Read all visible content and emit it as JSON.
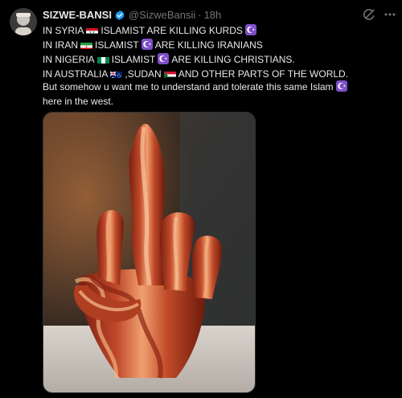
{
  "post": {
    "author_name": "SIZWE-BANSI",
    "handle": "@SizweBansii",
    "separator": "·",
    "time": "18h",
    "lines": {
      "l1a": "IN SYRIA",
      "l1b": "ISLAMIST ARE KILLING KURDS",
      "l2a": "IN IRAN",
      "l2b": "ISLAMIST",
      "l2c": "ARE KILLING IRANIANS",
      "l3a": "IN NIGERIA",
      "l3b": "ISLAMIST",
      "l3c": "ARE KILLING CHRISTIANS.",
      "l4a": "IN AUSTRALIA",
      "l4b": ",SUDAN",
      "l4c": "AND OTHER PARTS OF THE WORLD.",
      "l5a": "But somehow u want me to understand and tolerate this same Islam",
      "l6a": "here in the west."
    }
  },
  "icons": {
    "verified": "verified-badge-icon",
    "grok": "grok-icon",
    "more": "more-icon",
    "crescent": "star-and-crescent-emoji"
  },
  "colors": {
    "background": "#000000",
    "text": "#e7e9ea",
    "secondary": "#71767b",
    "verified": "#1d9bf0",
    "emoji_purple": "#7f4fc9"
  }
}
